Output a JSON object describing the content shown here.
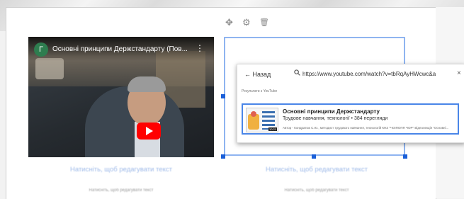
{
  "editor": {
    "toolbar": {
      "move_icon": "✥",
      "settings_icon": "⚙",
      "delete_icon": "🗑"
    }
  },
  "video_block": {
    "channel_initial": "Г",
    "title": "Основні принципи Держстандарту (Пов...",
    "menu_icon": "⋮",
    "play_icon": "play-icon"
  },
  "youtube_picker": {
    "back_label": "Назад",
    "back_icon": "←",
    "search_icon": "🔍",
    "url_value": "https://www.youtube.com/watch?v=tbRqAyHWcwc&a",
    "close_icon": "×",
    "results_label": "Результати з YouTube",
    "result": {
      "title": "Основні принципи Держстандарту",
      "meta": "Трудове навчання, технології • 384 перегляди",
      "description": "Автор - Кондратюк С.Ю., методист трудового навчання, технологій КНЗ \"ЧОІПОПП ЧОР\" Відеолекція \"Основні...",
      "duration": "10:21"
    }
  },
  "captions": {
    "left_caption": "Натисніть, щоб редагувати текст",
    "right_caption": "Натисніть, щоб редагувати текст",
    "left_sub": "Натисніть, щоб редагувати текст",
    "right_sub": "Натисніть, щоб редагувати текст"
  },
  "colors": {
    "selection": "#1a5fd8",
    "accent": "#4a86e8",
    "play": "#ff0000"
  }
}
